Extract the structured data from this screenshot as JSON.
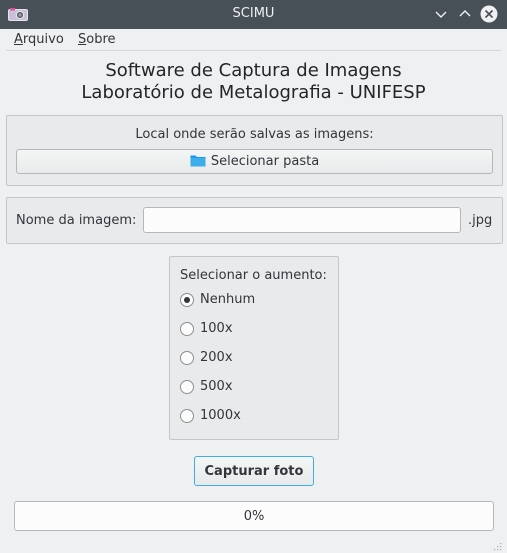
{
  "window": {
    "title": "SCIMU",
    "icons": [
      "camera-icon",
      "minimize-icon",
      "maximize-icon",
      "close-icon"
    ]
  },
  "menubar": {
    "items": [
      {
        "first": "A",
        "rest": "rquivo"
      },
      {
        "first": "S",
        "rest": "obre"
      }
    ]
  },
  "header": {
    "line1": "Software de Captura de Imagens",
    "line2": "Laboratório de Metalografia - UNIFESP"
  },
  "folder": {
    "label": "Local onde serão salvas as imagens:",
    "button_label": "Selecionar pasta",
    "icon": "folder-icon"
  },
  "image_name": {
    "label": "Nome da imagem:",
    "value": "",
    "placeholder": "",
    "extension": ".jpg"
  },
  "zoom": {
    "title": "Selecionar o aumento:",
    "options": [
      {
        "label": "Nenhum",
        "checked": true
      },
      {
        "label": "100x",
        "checked": false
      },
      {
        "label": "200x",
        "checked": false
      },
      {
        "label": "500x",
        "checked": false
      },
      {
        "label": "1000x",
        "checked": false
      }
    ]
  },
  "capture": {
    "button_label": "Capturar foto"
  },
  "progress": {
    "value": 0,
    "text": "0%"
  },
  "colors": {
    "titlebar": "#475057",
    "accent": "#3daee9",
    "background": "#eff0f1",
    "folder_icon": "#1d99f3"
  }
}
